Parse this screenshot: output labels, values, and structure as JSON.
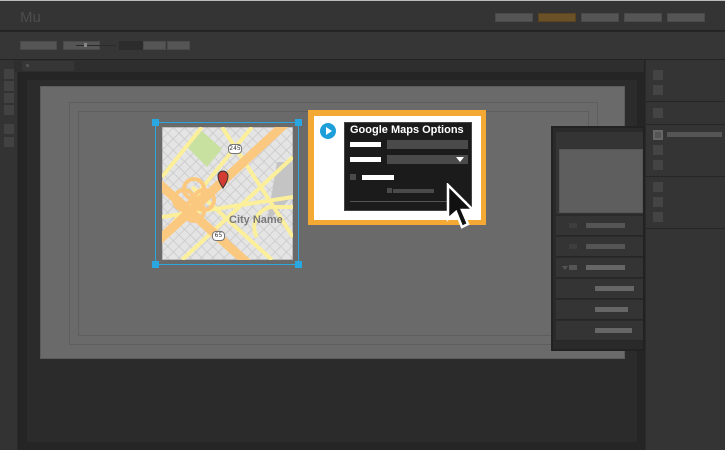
{
  "app": {
    "logo": "Mu",
    "accent": "#6b5127",
    "selection_color": "#2aa6e0",
    "widget_color": "#f5a935"
  },
  "map": {
    "city_label": "City Name",
    "route_shields": [
      "245",
      "65"
    ],
    "pin_color": "#d33a32"
  },
  "widget": {
    "title": "Google Maps Options",
    "play_icon": "play-icon",
    "dropdown_icon": "chevron-down-icon"
  }
}
